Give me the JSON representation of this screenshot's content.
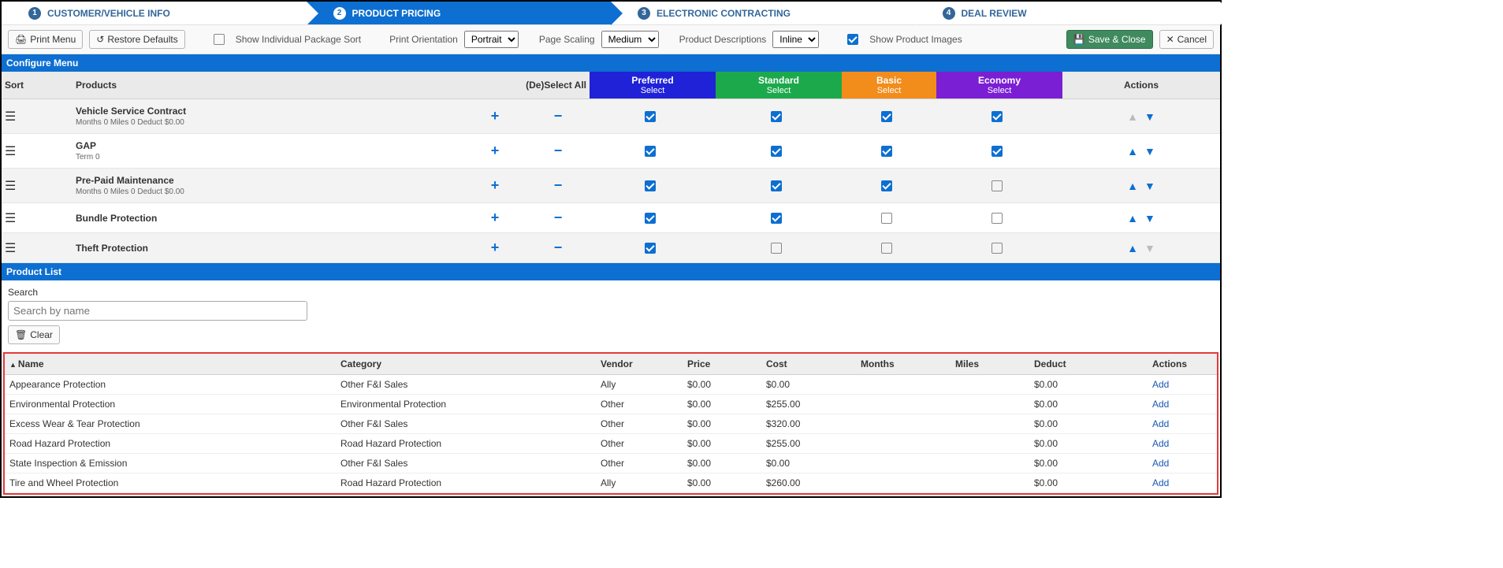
{
  "wizard": {
    "steps": [
      {
        "num": "1",
        "label": "CUSTOMER/VEHICLE INFO"
      },
      {
        "num": "2",
        "label": "PRODUCT PRICING"
      },
      {
        "num": "3",
        "label": "ELECTRONIC CONTRACTING"
      },
      {
        "num": "4",
        "label": "DEAL REVIEW"
      }
    ]
  },
  "toolbar": {
    "print_menu": "Print Menu",
    "restore_defaults": "Restore Defaults",
    "show_individual": "Show Individual Package Sort",
    "print_orientation_label": "Print Orientation",
    "print_orientation_value": "Portrait",
    "page_scaling_label": "Page Scaling",
    "page_scaling_value": "Medium",
    "product_desc_label": "Product Descriptions",
    "product_desc_value": "Inline",
    "show_images": "Show Product Images",
    "save_close": "Save & Close",
    "cancel": "Cancel"
  },
  "sections": {
    "configure": "Configure Menu",
    "product_list": "Product List"
  },
  "cfg_header": {
    "sort": "Sort",
    "products": "Products",
    "deselect": "(De)Select All",
    "actions": "Actions",
    "select": "Select",
    "tiers": {
      "preferred": "Preferred",
      "standard": "Standard",
      "basic": "Basic",
      "economy": "Economy"
    }
  },
  "cfg_rows": [
    {
      "name": "Vehicle Service Contract",
      "sub": "Months 0  Miles 0  Deduct $0.00",
      "pref": true,
      "std": true,
      "basic": true,
      "econ": true,
      "up_dim": true,
      "down_dim": false
    },
    {
      "name": "GAP",
      "sub": "Term 0",
      "pref": true,
      "std": true,
      "basic": true,
      "econ": true,
      "up_dim": false,
      "down_dim": false
    },
    {
      "name": "Pre-Paid Maintenance",
      "sub": "Months 0  Miles 0  Deduct $0.00",
      "pref": true,
      "std": true,
      "basic": true,
      "econ": false,
      "up_dim": false,
      "down_dim": false
    },
    {
      "name": "Bundle Protection",
      "sub": "",
      "pref": true,
      "std": true,
      "basic": false,
      "econ": false,
      "up_dim": false,
      "down_dim": false
    },
    {
      "name": "Theft Protection",
      "sub": "",
      "pref": true,
      "std": false,
      "basic": false,
      "econ": false,
      "up_dim": false,
      "down_dim": true
    }
  ],
  "search": {
    "label": "Search",
    "placeholder": "Search by name",
    "clear": "Clear"
  },
  "pl_header": {
    "name": "Name",
    "category": "Category",
    "vendor": "Vendor",
    "price": "Price",
    "cost": "Cost",
    "months": "Months",
    "miles": "Miles",
    "deduct": "Deduct",
    "actions": "Actions"
  },
  "pl_rows": [
    {
      "name": "Appearance Protection",
      "category": "Other F&I Sales",
      "vendor": "Ally",
      "price": "$0.00",
      "cost": "$0.00",
      "months": "",
      "miles": "",
      "deduct": "$0.00",
      "action": "Add"
    },
    {
      "name": "Environmental Protection",
      "category": "Environmental Protection",
      "vendor": "Other",
      "price": "$0.00",
      "cost": "$255.00",
      "months": "",
      "miles": "",
      "deduct": "$0.00",
      "action": "Add"
    },
    {
      "name": "Excess Wear & Tear Protection",
      "category": "Other F&I Sales",
      "vendor": "Other",
      "price": "$0.00",
      "cost": "$320.00",
      "months": "",
      "miles": "",
      "deduct": "$0.00",
      "action": "Add"
    },
    {
      "name": "Road Hazard Protection",
      "category": "Road Hazard Protection",
      "vendor": "Other",
      "price": "$0.00",
      "cost": "$255.00",
      "months": "",
      "miles": "",
      "deduct": "$0.00",
      "action": "Add"
    },
    {
      "name": "State Inspection & Emission",
      "category": "Other F&I Sales",
      "vendor": "Other",
      "price": "$0.00",
      "cost": "$0.00",
      "months": "",
      "miles": "",
      "deduct": "$0.00",
      "action": "Add"
    },
    {
      "name": "Tire and Wheel Protection",
      "category": "Road Hazard Protection",
      "vendor": "Ally",
      "price": "$0.00",
      "cost": "$260.00",
      "months": "",
      "miles": "",
      "deduct": "$0.00",
      "action": "Add"
    }
  ]
}
